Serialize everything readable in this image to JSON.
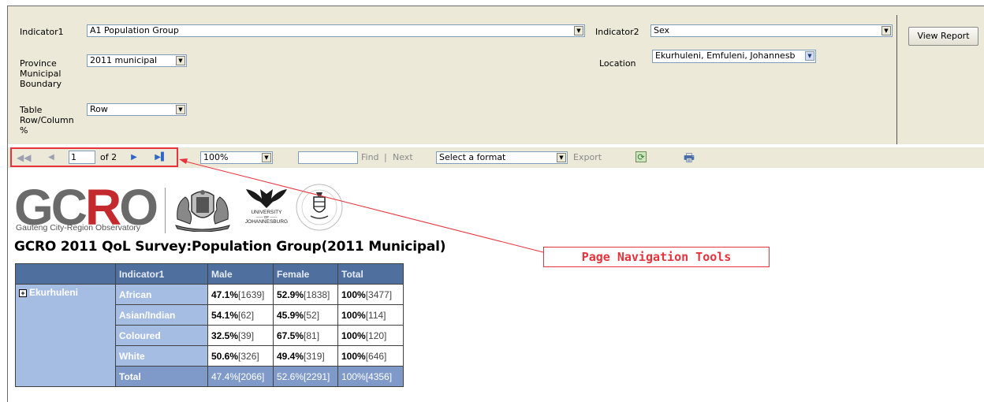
{
  "params": {
    "indicator1": {
      "label": "Indicator1",
      "value": "A1 Population Group"
    },
    "indicator2": {
      "label": "Indicator2",
      "value": "Sex"
    },
    "boundary": {
      "label_line1": "Province",
      "label_line2": "Municipal",
      "label_line3": "Boundary",
      "value": "2011 municipal"
    },
    "location": {
      "label": "Location",
      "value": "Ekurhuleni, Emfuleni, Johannesb"
    },
    "table_pct": {
      "label_line1": "Table",
      "label_line2": "Row/Column",
      "label_line3": "%",
      "value": "Row"
    },
    "view_report": "View Report"
  },
  "toolbar": {
    "page_input": "1",
    "of_pages": "of 2",
    "zoom": "100%",
    "find_value": "",
    "find": "Find",
    "find_sep": "|",
    "next": "Next",
    "export_format": "Select a format",
    "export": "Export",
    "icons": [
      "first-page-icon",
      "previous-page-icon",
      "next-page-icon",
      "last-page-icon",
      "refresh-icon",
      "print-icon"
    ]
  },
  "annotation": "Page Navigation Tools",
  "logos": {
    "gcro_g": "G",
    "gcro_c": "C",
    "gcro_r": "R",
    "gcro_o": "O",
    "gcro_subtitle": "Gauteng City-Region Observatory",
    "uj_line1": "UNIVERSITY",
    "uj_line2": "—— OF ——",
    "uj_line3": "JOHANNESBURG"
  },
  "report": {
    "title": "GCRO 2011 QoL Survey:Population Group(2011 Municipal)",
    "headers": [
      "",
      "Indicator1",
      "Male",
      "Female",
      "Total"
    ],
    "group": "Ekurhuleni",
    "rows": [
      {
        "cat": "African",
        "male_pct": "47.1%",
        "male_n": "[1639]",
        "female_pct": "52.9%",
        "female_n": "[1838]",
        "total_pct": "100%",
        "total_n": "[3477]"
      },
      {
        "cat": "Asian/Indian",
        "male_pct": "54.1%",
        "male_n": "[62]",
        "female_pct": "45.9%",
        "female_n": "[52]",
        "total_pct": "100%",
        "total_n": "[114]"
      },
      {
        "cat": "Coloured",
        "male_pct": "32.5%",
        "male_n": "[39]",
        "female_pct": "67.5%",
        "female_n": "[81]",
        "total_pct": "100%",
        "total_n": "[120]"
      },
      {
        "cat": "White",
        "male_pct": "50.6%",
        "male_n": "[326]",
        "female_pct": "49.4%",
        "female_n": "[319]",
        "total_pct": "100%",
        "total_n": "[646]"
      }
    ],
    "total": {
      "cat": "Total",
      "male": "47.4%[2066]",
      "female": "52.6%[2291]",
      "total": "100%[4356]"
    }
  },
  "colors": {
    "param_bg": "#ece9d8",
    "header_bg": "#4f6f9f",
    "category_bg": "#a6bde3",
    "total_bg": "#7f9ac9",
    "annotation": "#e8323c",
    "gcro_red": "#c4292d",
    "gcro_grey": "#6a6a6a"
  }
}
